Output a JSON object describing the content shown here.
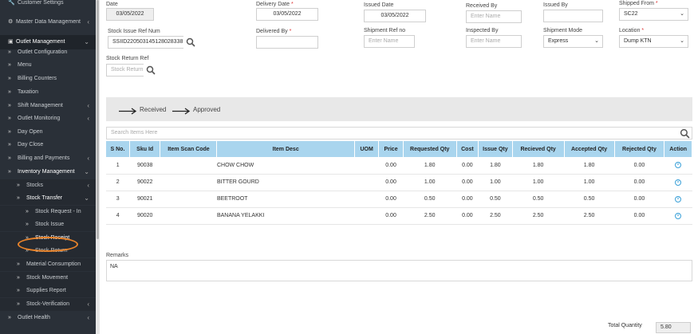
{
  "sidebar": {
    "top": [
      {
        "label": "Customer Settings",
        "icon": "wrench-icon"
      },
      {
        "label": "Master Data Management",
        "icon": "gear-icon"
      },
      {
        "label": "Outlet Management",
        "icon": "store-icon"
      }
    ],
    "outlet_items": [
      "Outlet Configuration",
      "Menu",
      "Billing Counters",
      "Taxation",
      "Shift Management",
      "Outlet Monitoring",
      "Day Open",
      "Day Close",
      "Billing and Payments",
      "Inventory Management",
      "Stocks",
      "Stock Transfer",
      "Stock Request - In",
      "Stock Issue",
      "Stock Receipt",
      "Stock Return",
      "Material Consumption",
      "Stock Movement",
      "Supplies Report",
      "Stock-Verification",
      "Outlet Health"
    ]
  },
  "form": {
    "date_label": "Date",
    "date_value": "03/05/2022",
    "delivery_date_label": "Delivery Date",
    "delivery_date_value": "03/05/2022",
    "issued_date_label": "Issued Date",
    "issued_date_value": "03/05/2022",
    "received_by_label": "Received By",
    "received_by_placeholder": "Enter Name",
    "issued_by_label": "Issued By",
    "issued_by_value": "",
    "shipped_from_label": "Shipped From",
    "shipped_from_value": "SC22",
    "issue_ref_label": "Stock Issue Ref Num",
    "issue_ref_value": "SSIID220503145128028338",
    "delivered_by_label": "Delivered By",
    "delivered_by_value": "",
    "shipment_ref_label": "Shipment Ref no",
    "shipment_ref_placeholder": "Enter Name",
    "inspected_by_label": "Inspected By",
    "inspected_by_placeholder": "Enter Name",
    "shipment_mode_label": "Shipment Mode",
    "shipment_mode_value": "Express",
    "location_label": "Location",
    "location_value": "Dump KTN",
    "return_ref_label": "Stock Return Ref",
    "return_ref_placeholder": "Stock Return",
    "required_mark": "*"
  },
  "workflow": {
    "received": "Received",
    "approved": "Approved"
  },
  "search": {
    "placeholder": "Search Items Here"
  },
  "table": {
    "headers": [
      "S No.",
      "Sku Id",
      "Item Scan Code",
      "Item Desc",
      "UOM",
      "Price",
      "Requested Qty",
      "Cost",
      "Issue Qty",
      "Recieved Qty",
      "Accepted Qty",
      "Rejected Qty",
      "Action"
    ],
    "rows": [
      [
        "1",
        "90038",
        "",
        "CHOW CHOW",
        "",
        "0.00",
        "1.80",
        "0.00",
        "1.80",
        "1.80",
        "1.80",
        "0.00"
      ],
      [
        "2",
        "90022",
        "",
        "BITTER GOURD",
        "",
        "0.00",
        "1.00",
        "0.00",
        "1.00",
        "1.00",
        "1.00",
        "0.00"
      ],
      [
        "3",
        "90021",
        "",
        "BEETROOT",
        "",
        "0.00",
        "0.50",
        "0.00",
        "0.50",
        "0.50",
        "0.50",
        "0.00"
      ],
      [
        "4",
        "90020",
        "",
        "BANANA YELAKKI",
        "",
        "0.00",
        "2.50",
        "0.00",
        "2.50",
        "2.50",
        "2.50",
        "0.00"
      ]
    ]
  },
  "remarks": {
    "label": "Remarks",
    "value": "NA"
  },
  "total": {
    "label": "Total Quantity",
    "value": "5.80"
  }
}
